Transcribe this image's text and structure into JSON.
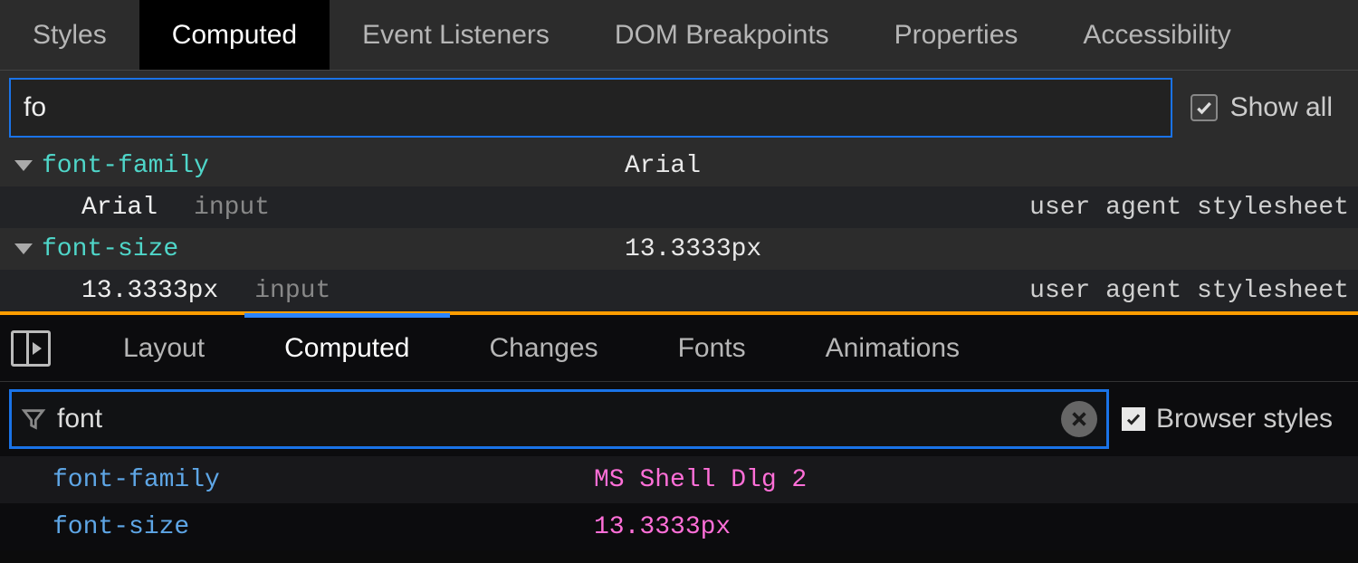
{
  "top": {
    "tabs": [
      "Styles",
      "Computed",
      "Event Listeners",
      "DOM Breakpoints",
      "Properties",
      "Accessibility"
    ],
    "active_tab_index": 1,
    "filter_value": "fo",
    "show_all_label": "Show all",
    "show_all_checked": true,
    "props": [
      {
        "name": "font-family",
        "value": "Arial",
        "trace_value": "Arial",
        "trace_selector": "input",
        "trace_source": "user agent stylesheet"
      },
      {
        "name": "font-size",
        "value": "13.3333px",
        "trace_value": "13.3333px",
        "trace_selector": "input",
        "trace_source": "user agent stylesheet"
      }
    ]
  },
  "bottom": {
    "tabs": [
      "Layout",
      "Computed",
      "Changes",
      "Fonts",
      "Animations"
    ],
    "active_tab_index": 1,
    "filter_value": "font",
    "browser_styles_label": "Browser styles",
    "browser_styles_checked": true,
    "props": [
      {
        "name": "font-family",
        "value": "MS Shell Dlg 2"
      },
      {
        "name": "font-size",
        "value": "13.3333px"
      }
    ]
  }
}
